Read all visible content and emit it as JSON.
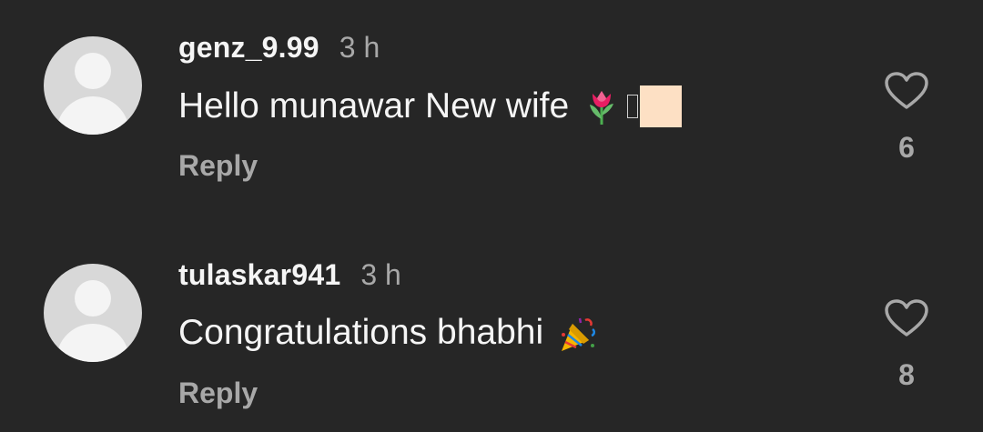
{
  "comments": [
    {
      "username": "genz_9.99",
      "time": "3 h",
      "text": "Hello munawar New wife",
      "emoji": "tulip-icon",
      "reply_label": "Reply",
      "likes": "6"
    },
    {
      "username": "tulaskar941",
      "time": "3 h",
      "text": "Congratulations bhabhi",
      "emoji": "party-popper-icon",
      "reply_label": "Reply",
      "likes": "8"
    }
  ],
  "colors": {
    "background": "#262626",
    "primary_text": "#f5f5f5",
    "secondary_text": "#a8a8a8",
    "avatar_bg": "#d8d8d8",
    "tone_square": "#fde0c4"
  }
}
